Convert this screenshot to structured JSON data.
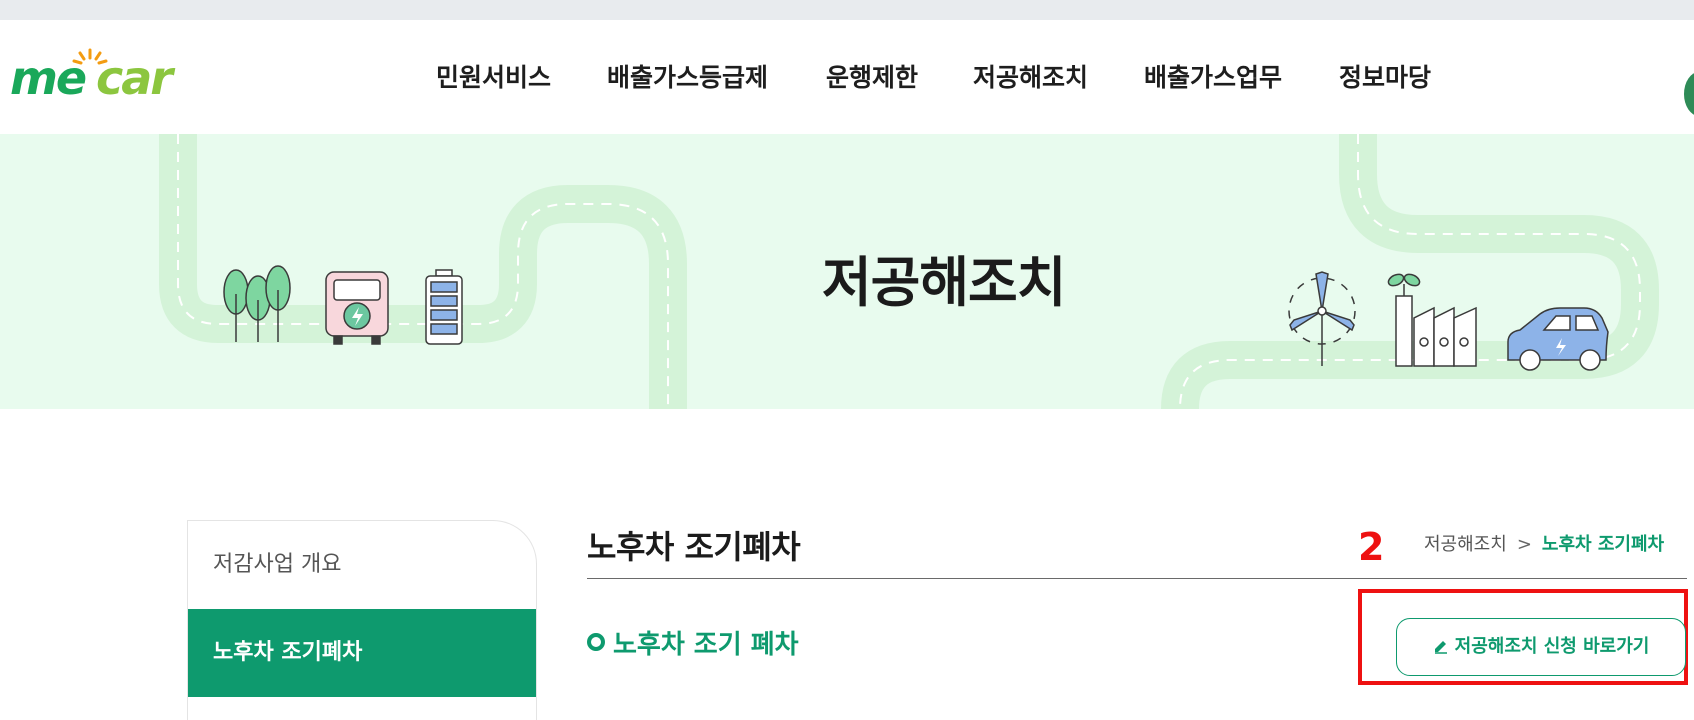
{
  "header": {
    "logo_text": "mecar",
    "nav": [
      {
        "label": "민원서비스"
      },
      {
        "label": "배출가스등급제"
      },
      {
        "label": "운행제한"
      },
      {
        "label": "저공해조치"
      },
      {
        "label": "배출가스업무"
      },
      {
        "label": "정보마당"
      }
    ]
  },
  "banner": {
    "title": "저공해조치"
  },
  "sidebar": {
    "items": [
      {
        "label": "저감사업 개요",
        "active": false
      },
      {
        "label": "노후차 조기폐차",
        "active": true
      }
    ]
  },
  "main": {
    "heading": "노후차 조기폐차",
    "step_marker": "2",
    "breadcrumb": {
      "parent": "저공해조치",
      "separator": ">",
      "current": "노후차 조기폐차"
    },
    "section_title": "노후차 조기 폐차",
    "apply_button": {
      "label": "저공해조치 신청 바로가기",
      "icon": "pencil-icon"
    }
  },
  "colors": {
    "brand_green": "#0e9a6e",
    "banner_bg": "#e8fbee",
    "highlight_red": "#ee1111"
  }
}
